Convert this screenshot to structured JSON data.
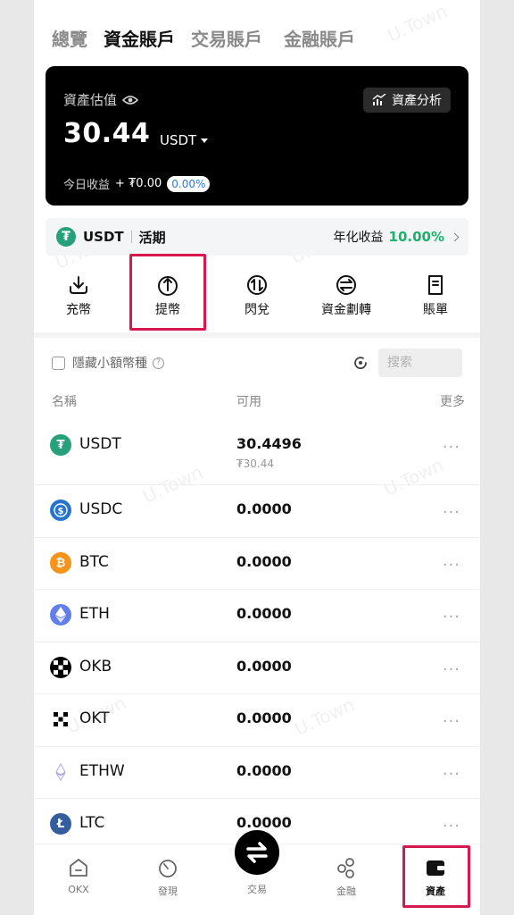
{
  "tabs": [
    "總覽",
    "資金賬戶",
    "交易賬戶",
    "金融賬戶"
  ],
  "active_tab": 1,
  "card": {
    "label": "資產估值",
    "value": "30.44",
    "unit": "USDT",
    "analysis_label": "資產分析",
    "income_label": "今日收益",
    "income_value": "+ ₮0.00",
    "income_pct": "0.00%"
  },
  "earn": {
    "coin": "USDT",
    "term": "活期",
    "apy_label": "年化收益",
    "apy": "10.00%"
  },
  "actions": [
    {
      "label": "充幣",
      "icon": "deposit-icon"
    },
    {
      "label": "提幣",
      "icon": "withdraw-icon"
    },
    {
      "label": "閃兌",
      "icon": "convert-icon"
    },
    {
      "label": "資金劃轉",
      "icon": "transfer-icon"
    },
    {
      "label": "賬單",
      "icon": "bill-icon"
    }
  ],
  "filter": {
    "hide_small_label": "隱藏小額幣種",
    "search_placeholder": "搜索"
  },
  "table_header": {
    "name": "名稱",
    "available": "可用",
    "more": "更多"
  },
  "coins": [
    {
      "name": "USDT",
      "amount": "30.4496",
      "sub": "₮30.44",
      "icon": "tether-icon",
      "color": "#26a17b"
    },
    {
      "name": "USDC",
      "amount": "0.0000",
      "icon": "usdc-icon",
      "color": "#2775ca"
    },
    {
      "name": "BTC",
      "amount": "0.0000",
      "icon": "bitcoin-icon",
      "color": "#f7931a"
    },
    {
      "name": "ETH",
      "amount": "0.0000",
      "icon": "ethereum-icon",
      "color": "#627eea"
    },
    {
      "name": "OKB",
      "amount": "0.0000",
      "icon": "okb-icon",
      "color": "#000000"
    },
    {
      "name": "OKT",
      "amount": "0.0000",
      "icon": "okt-icon",
      "color": "#ffffff"
    },
    {
      "name": "ETHW",
      "amount": "0.0000",
      "icon": "ethw-icon",
      "color": "#ffffff"
    },
    {
      "name": "LTC",
      "amount": "0.0000",
      "icon": "litecoin-icon",
      "color": "#345d9d"
    }
  ],
  "more_dots": "···",
  "bottom_nav": [
    {
      "label": "OKX",
      "icon": "home-icon"
    },
    {
      "label": "發現",
      "icon": "discover-icon"
    },
    {
      "label": "交易",
      "icon": "trade-icon"
    },
    {
      "label": "金融",
      "icon": "finance-icon"
    },
    {
      "label": "資產",
      "icon": "wallet-icon"
    }
  ],
  "active_nav": 4,
  "watermark": "U.Town",
  "colors": {
    "accent_green": "#1bb26b",
    "highlight": "#d6184e",
    "badge_blue": "#2a7ae2"
  }
}
